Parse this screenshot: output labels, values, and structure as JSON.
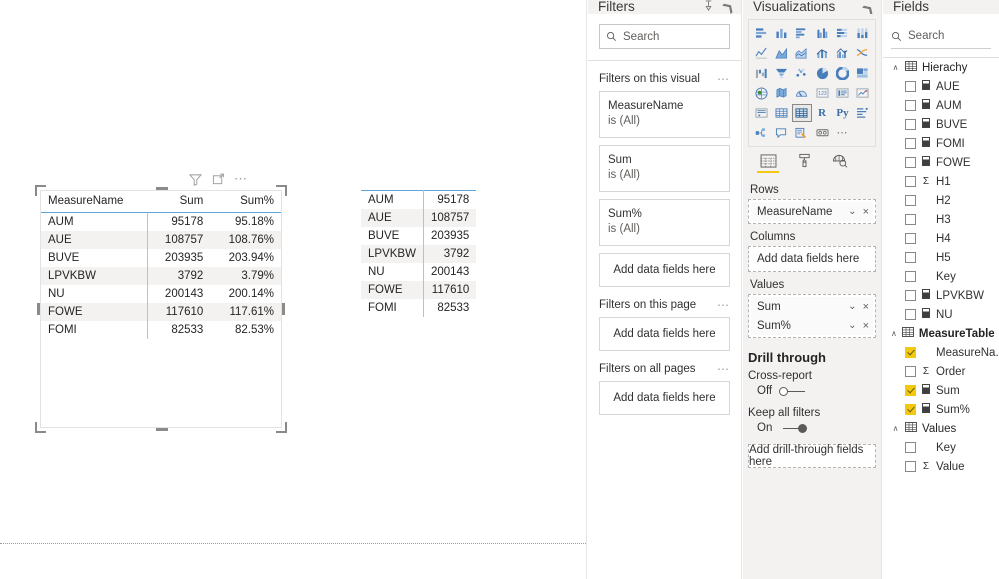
{
  "canvas": {
    "visual1": {
      "toolbar": [
        "filter-icon",
        "focus-mode-icon",
        "more-options-icon"
      ],
      "headers": [
        "MeasureName",
        "Sum",
        "Sum%"
      ],
      "rows": [
        [
          "AUM",
          "95178",
          "95.18%"
        ],
        [
          "AUE",
          "108757",
          "108.76%"
        ],
        [
          "BUVE",
          "203935",
          "203.94%"
        ],
        [
          "LPVKBW",
          "3792",
          "3.79%"
        ],
        [
          "NU",
          "200143",
          "200.14%"
        ],
        [
          "FOWE",
          "117610",
          "117.61%"
        ],
        [
          "FOMI",
          "82533",
          "82.53%"
        ]
      ]
    },
    "visual2": {
      "rows": [
        [
          "AUM",
          "95178"
        ],
        [
          "AUE",
          "108757"
        ],
        [
          "BUVE",
          "203935"
        ],
        [
          "LPVKBW",
          "3792"
        ],
        [
          "NU",
          "200143"
        ],
        [
          "FOWE",
          "117610"
        ],
        [
          "FOMI",
          "82533"
        ]
      ]
    }
  },
  "filters_pane": {
    "title": "Filters",
    "search_placeholder": "Search",
    "groups": [
      {
        "label": "Filters on this visual",
        "cards": [
          {
            "name": "MeasureName",
            "value": "is (All)"
          },
          {
            "name": "Sum",
            "value": "is (All)"
          },
          {
            "name": "Sum%",
            "value": "is (All)"
          }
        ],
        "drop_label": "Add data fields here"
      },
      {
        "label": "Filters on this page",
        "cards": [],
        "drop_label": "Add data fields here"
      },
      {
        "label": "Filters on all pages",
        "cards": [],
        "drop_label": "Add data fields here"
      }
    ]
  },
  "viz_pane": {
    "title": "Visualizations",
    "gallery": [
      "stacked-bar-chart-icon",
      "stacked-column-chart-icon",
      "clustered-bar-chart-icon",
      "clustered-column-chart-icon",
      "100-stacked-bar-chart-icon",
      "100-stacked-column-chart-icon",
      "line-chart-icon",
      "area-chart-icon",
      "stacked-area-chart-icon",
      "line-stacked-column-chart-icon",
      "line-clustered-column-chart-icon",
      "ribbon-chart-icon",
      "waterfall-chart-icon",
      "funnel-chart-icon",
      "scatter-chart-icon",
      "pie-chart-icon",
      "donut-chart-icon",
      "treemap-icon",
      "map-icon",
      "filled-map-icon",
      "gauge-icon",
      "card-icon",
      "multi-row-card-icon",
      "kpi-icon",
      "slicer-icon",
      "table-icon",
      "matrix-icon",
      "r-script-visual-icon",
      "python-visual-icon",
      "key-influencers-icon",
      "decomposition-tree-icon",
      "smart-narrative-icon",
      "paginated-report-icon",
      "arcgis-map-icon",
      "get-more-visuals-icon"
    ],
    "gallery_selected_index": 26,
    "gallery_text_icons": {
      "27": "R",
      "28": "Py"
    },
    "well_tabs": [
      {
        "name": "fields-tab",
        "icon": "fields-table-icon",
        "active": true
      },
      {
        "name": "format-tab",
        "icon": "paint-roller-icon",
        "active": false
      },
      {
        "name": "analytics-tab",
        "icon": "magnifier-analytics-icon",
        "active": false
      }
    ],
    "wells": [
      {
        "label": "Rows",
        "chips": [
          {
            "name": "MeasureName"
          }
        ],
        "empty_label": null
      },
      {
        "label": "Columns",
        "chips": [],
        "empty_label": "Add data fields here"
      },
      {
        "label": "Values",
        "chips": [
          {
            "name": "Sum"
          },
          {
            "name": "Sum%"
          }
        ],
        "empty_label": null
      }
    ],
    "drill": {
      "title": "Drill through",
      "cross_report_label": "Cross-report",
      "cross_report_state": "Off",
      "keep_filters_label": "Keep all filters",
      "keep_filters_state": "On",
      "drop_label": "Add drill-through fields here"
    }
  },
  "fields_pane": {
    "title": "Fields",
    "search_placeholder": "Search",
    "tables": [
      {
        "name": "Hierachy",
        "expanded": true,
        "bold": false,
        "fields": [
          {
            "label": "AUE",
            "checked": false,
            "icon": "calc-column"
          },
          {
            "label": "AUM",
            "checked": false,
            "icon": "calc-column"
          },
          {
            "label": "BUVE",
            "checked": false,
            "icon": "calc-column"
          },
          {
            "label": "FOMI",
            "checked": false,
            "icon": "calc-column"
          },
          {
            "label": "FOWE",
            "checked": false,
            "icon": "calc-column"
          },
          {
            "label": "H1",
            "checked": false,
            "icon": "sigma"
          },
          {
            "label": "H2",
            "checked": false,
            "icon": "none"
          },
          {
            "label": "H3",
            "checked": false,
            "icon": "none"
          },
          {
            "label": "H4",
            "checked": false,
            "icon": "none"
          },
          {
            "label": "H5",
            "checked": false,
            "icon": "none"
          },
          {
            "label": "Key",
            "checked": false,
            "icon": "none"
          },
          {
            "label": "LPVKBW",
            "checked": false,
            "icon": "calc-column"
          },
          {
            "label": "NU",
            "checked": false,
            "icon": "calc-column"
          }
        ]
      },
      {
        "name": "MeasureTable",
        "expanded": true,
        "bold": true,
        "fields": [
          {
            "label": "MeasureNa...",
            "checked": true,
            "icon": "none"
          },
          {
            "label": "Order",
            "checked": false,
            "icon": "sigma"
          },
          {
            "label": "Sum",
            "checked": true,
            "icon": "calc-column"
          },
          {
            "label": "Sum%",
            "checked": true,
            "icon": "calc-column"
          }
        ]
      },
      {
        "name": "Values",
        "expanded": true,
        "bold": false,
        "fields": [
          {
            "label": "Key",
            "checked": false,
            "icon": "none"
          },
          {
            "label": "Value",
            "checked": false,
            "icon": "sigma"
          }
        ]
      }
    ]
  },
  "colors": {
    "accent_yellow": "#f2c811",
    "table_rule_blue": "#60a5d8",
    "pane_bg": "#f3f2f1",
    "viz_icon_blue": "#4a7ebb"
  }
}
